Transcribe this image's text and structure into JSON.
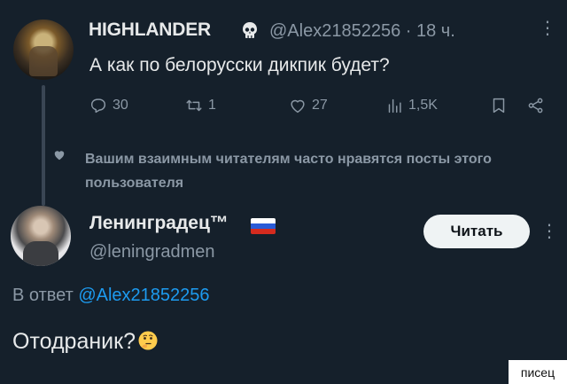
{
  "tweet1": {
    "author_name": "HIGHLANDER",
    "author_handle": "@Alex21852256",
    "timestamp": "· 18 ч.",
    "text": "А как по белорусски дикпик будет?",
    "stats": {
      "replies": "30",
      "retweets": "1",
      "likes": "27",
      "views": "1,5K"
    }
  },
  "engagement_note": "Вашим взаимным читателям часто нравятся посты этого пользователя",
  "tweet2": {
    "author_name": "Ленинградец™",
    "author_handle": "@leningradmen",
    "follow_label": "Читать",
    "reply_prefix": "В ответ",
    "reply_handle": "@Alex21852256",
    "text": "Отодраник?"
  },
  "watermark": "писец",
  "colors": {
    "background": "#15202b",
    "text": "#e7e9ea",
    "muted": "#8b98a5",
    "link": "#1d9bf0"
  }
}
